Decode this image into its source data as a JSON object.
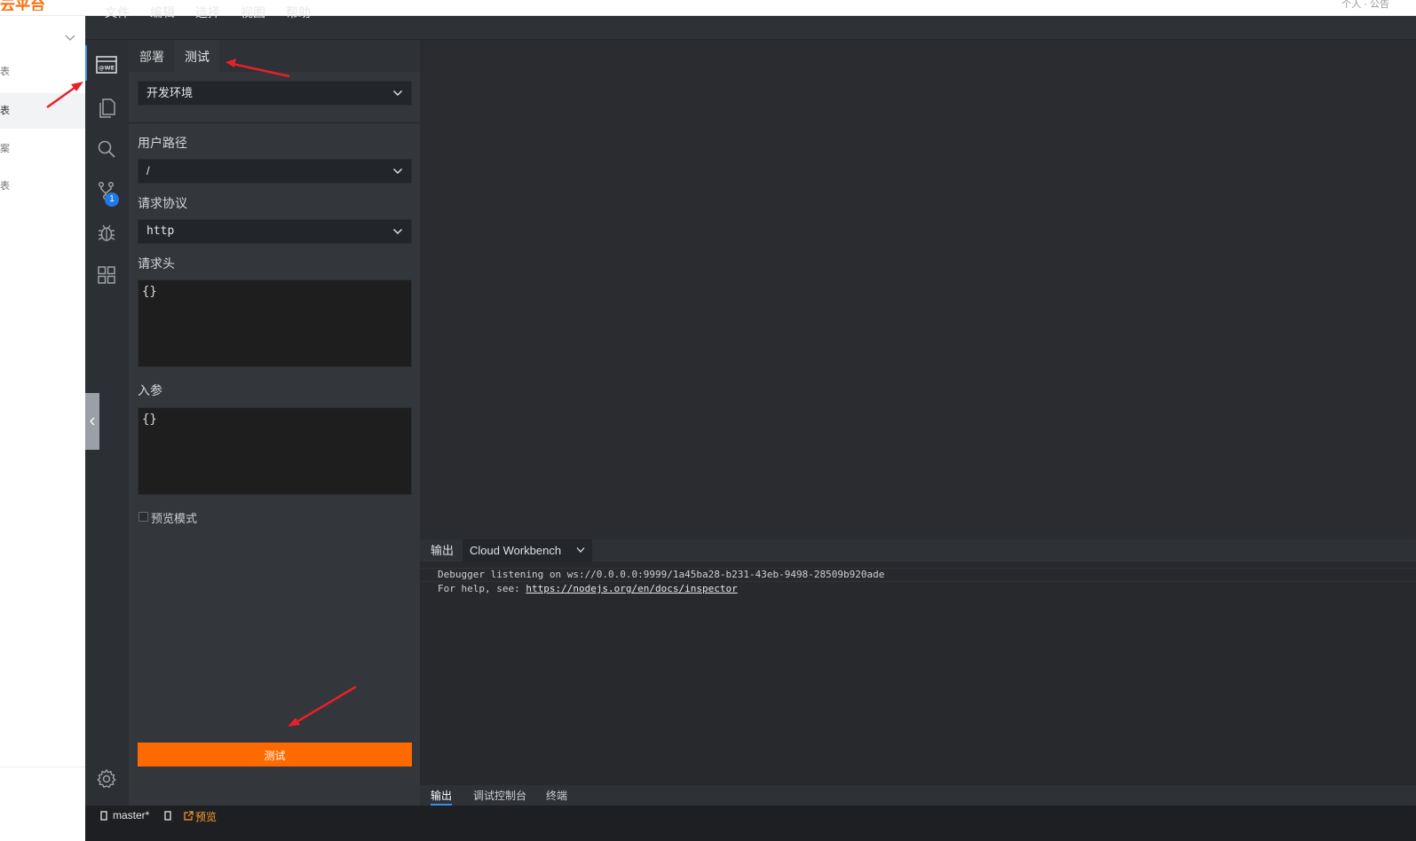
{
  "host": {
    "logo": "云平台",
    "topbar_right": "个人 · 公告",
    "sidebar_items": [
      "表",
      "表",
      "案",
      "表"
    ],
    "active_index": 1
  },
  "menu": [
    "文件",
    "编辑",
    "选择",
    "视图",
    "帮助"
  ],
  "activity_bar": {
    "icons": [
      "web-panel-icon",
      "files-icon",
      "search-icon",
      "source-control-icon",
      "debug-icon",
      "extensions-icon"
    ],
    "source_control_badge": "1",
    "settings_icon": "gear-icon"
  },
  "panel": {
    "tabs": [
      "部署",
      "测试"
    ],
    "active_tab": 1,
    "environment": "开发环境",
    "user_path_label": "用户路径",
    "user_path_value": "/",
    "protocol_label": "请求协议",
    "protocol_value": "http",
    "headers_label": "请求头",
    "headers_value": "{}",
    "params_label": "入参",
    "params_value": "{}",
    "preview_mode_label": "预览模式",
    "preview_mode_checked": false,
    "test_button": "测试"
  },
  "output": {
    "tab_label": "输出",
    "channel": "Cloud Workbench",
    "line1": "Debugger listening on ws://0.0.0.0:9999/1a45ba28-b231-43eb-9498-28509b920ade",
    "line2_prefix": "For help, see: ",
    "line2_link": "https://nodejs.org/en/docs/inspector"
  },
  "bottom_tabs": [
    "输出",
    "调试控制台",
    "终端"
  ],
  "bottom_active": 0,
  "status": {
    "branch": "master*",
    "preview": "预览"
  },
  "colors": {
    "accent": "#ff6a00",
    "activity_indicator": "#3b8eea",
    "annotation_arrow": "#e8202a"
  }
}
